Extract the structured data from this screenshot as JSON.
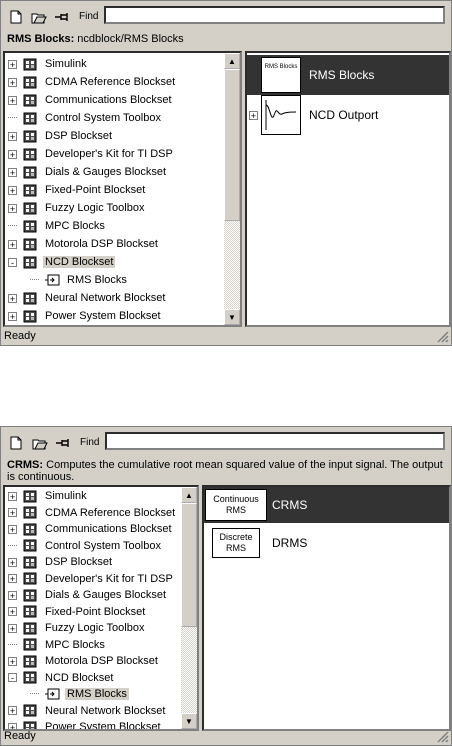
{
  "toolbar": {
    "new_icon": "new-document-icon",
    "open_icon": "open-folder-icon",
    "pin_icon": "pin-icon",
    "find_label": "Find",
    "find_value": ""
  },
  "window1": {
    "desc_title": "RMS Blocks:",
    "desc_text": " ncdblock/RMS Blocks",
    "tree": [
      {
        "label": "Simulink",
        "expander": "+"
      },
      {
        "label": "CDMA Reference Blockset",
        "expander": "+"
      },
      {
        "label": "Communications Blockset",
        "expander": "+"
      },
      {
        "label": "Control System Toolbox",
        "expander": ""
      },
      {
        "label": "DSP Blockset",
        "expander": "+"
      },
      {
        "label": "Developer's Kit for TI DSP",
        "expander": "+"
      },
      {
        "label": "Dials & Gauges Blockset",
        "expander": "+"
      },
      {
        "label": "Fixed-Point Blockset",
        "expander": "+"
      },
      {
        "label": "Fuzzy Logic Toolbox",
        "expander": "+"
      },
      {
        "label": "MPC Blocks",
        "expander": ""
      },
      {
        "label": "Motorola DSP Blockset",
        "expander": "+"
      },
      {
        "label": "NCD Blockset",
        "expander": "-"
      },
      {
        "label": "RMS Blocks",
        "expander": "",
        "child": true
      },
      {
        "label": "Neural Network Blockset",
        "expander": "+"
      },
      {
        "label": "Power System Blockset",
        "expander": "+"
      }
    ],
    "blocks": [
      {
        "name": "RMS Blocks",
        "icon_text": "RMS Blocks",
        "selected": true,
        "expander": ""
      },
      {
        "name": "NCD Outport",
        "icon_text": "",
        "selected": false,
        "expander": "+"
      }
    ],
    "status": "Ready"
  },
  "window2": {
    "desc_title": "CRMS:",
    "desc_text": " Computes the cumulative root mean squared value of the input signal. The output is continuous.",
    "tree": [
      {
        "label": "Simulink",
        "expander": "+"
      },
      {
        "label": "CDMA Reference Blockset",
        "expander": "+"
      },
      {
        "label": "Communications Blockset",
        "expander": "+"
      },
      {
        "label": "Control System Toolbox",
        "expander": ""
      },
      {
        "label": "DSP Blockset",
        "expander": "+"
      },
      {
        "label": "Developer's Kit for TI DSP",
        "expander": "+"
      },
      {
        "label": "Dials & Gauges Blockset",
        "expander": "+"
      },
      {
        "label": "Fixed-Point Blockset",
        "expander": "+"
      },
      {
        "label": "Fuzzy Logic Toolbox",
        "expander": "+"
      },
      {
        "label": "MPC Blocks",
        "expander": ""
      },
      {
        "label": "Motorola DSP Blockset",
        "expander": "+"
      },
      {
        "label": "NCD Blockset",
        "expander": "-"
      },
      {
        "label": "RMS Blocks",
        "expander": "",
        "child": true,
        "selected": true
      },
      {
        "label": "Neural Network Blockset",
        "expander": "+"
      },
      {
        "label": "Power System Blockset",
        "expander": "+"
      }
    ],
    "blocks": [
      {
        "name": "CRMS",
        "icon_text": "Continuous RMS",
        "selected": true
      },
      {
        "name": "DRMS",
        "icon_text": "Discrete RMS",
        "selected": false
      }
    ],
    "status": "Ready"
  },
  "colors": {
    "chrome": "#d4d0c8",
    "selection": "#333333",
    "library_icon": "#4a4a4a"
  }
}
